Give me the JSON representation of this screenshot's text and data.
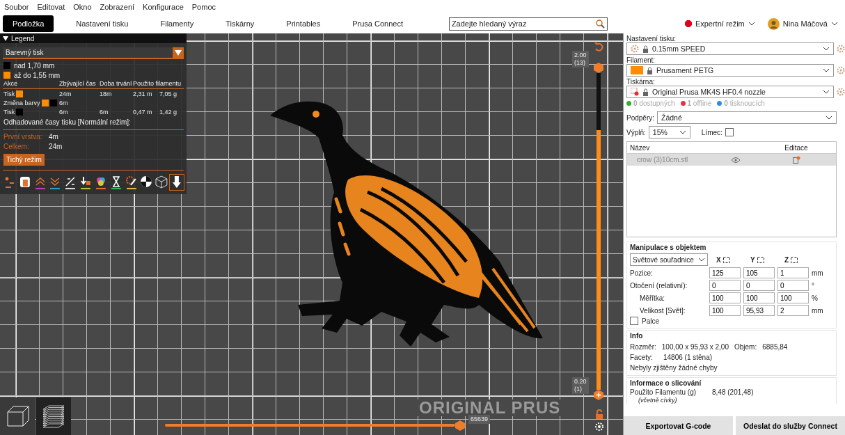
{
  "menu": [
    "Soubor",
    "Editovat",
    "Okno",
    "Zobrazení",
    "Konfigurace",
    "Pomoc"
  ],
  "tabs": [
    {
      "label": "Podložka",
      "selected": true
    },
    {
      "label": "Nastavení tisku",
      "selected": false
    },
    {
      "label": "Filamenty",
      "selected": false
    },
    {
      "label": "Tiskárny",
      "selected": false
    },
    {
      "label": "Printables",
      "selected": false
    },
    {
      "label": "Prusa Connect",
      "selected": false
    }
  ],
  "search": {
    "placeholder": "Zadejte hledaný výraz"
  },
  "mode": {
    "label": "Expertní režim",
    "color": "#e0001a"
  },
  "user": {
    "name": "Nina Máčová"
  },
  "legend": {
    "title": "Legend",
    "expanded": true,
    "view": "Barevný tisk",
    "ranges": [
      {
        "color": "#000000",
        "label": "nad 1,70 mm"
      },
      {
        "color": "#ff8c00",
        "label": "až do 1,55 mm"
      }
    ],
    "columns": [
      "Akce",
      "Zbývající čas",
      "Doba trvání",
      "Použito filamentu"
    ],
    "rows": [
      {
        "action": "Tisk",
        "colors": [
          {
            "color": "#ff8c00"
          }
        ],
        "remaining": "24m",
        "duration": "18m",
        "length": "2,31 m",
        "weight": "7,05 g"
      },
      {
        "action": "Změna barvy",
        "colors": [
          {
            "color": "#ff8c00"
          },
          {
            "color": "#000000"
          }
        ],
        "remaining": "6m",
        "duration": "",
        "length": "",
        "weight": ""
      },
      {
        "action": "Tisk",
        "colors": [
          {
            "color": "#000000"
          }
        ],
        "remaining": "6m",
        "duration": "6m",
        "length": "0,47 m",
        "weight": "1,42 g"
      }
    ],
    "estimate_title": "Odhadované časy tisku [Normální režim]:",
    "stats": [
      {
        "label": "První vrstva:",
        "value": "4m"
      },
      {
        "label": "Celkem:",
        "value": "24m"
      }
    ],
    "mode_button": "Tichý režim",
    "tools": [
      {
        "kind": "travel",
        "selected": false
      },
      {
        "kind": "wipe",
        "selected": false
      },
      {
        "kind": "retract",
        "selected": false
      },
      {
        "kind": "deretract",
        "selected": false
      },
      {
        "kind": "seams",
        "selected": false
      },
      {
        "kind": "toolchange",
        "selected": false
      },
      {
        "kind": "colors",
        "selected": false
      },
      {
        "kind": "pause",
        "selected": false
      },
      {
        "kind": "gcode",
        "selected": false
      },
      {
        "kind": "gravity",
        "selected": false
      },
      {
        "kind": "shells",
        "selected": false
      },
      {
        "kind": "marker",
        "selected": true
      }
    ]
  },
  "bed_logo": "ORIGINAL PRUS",
  "layer_slider": {
    "top_value": "2.00",
    "top_layer": "(13)",
    "bottom_value": "0.20",
    "bottom_layer": "(1)"
  },
  "move_slider": {
    "value": "65639",
    "level": 1
  },
  "print_settings": {
    "label": "Nastavení tisku:",
    "value": "0.15mm SPEED"
  },
  "filament": {
    "label": "Filament:",
    "value": "Prusament PETG",
    "color": "#ff8c00"
  },
  "printer": {
    "label": "Tiskárna:",
    "value": "Original Prusa MK4S HF0.4 nozzle"
  },
  "printer_status": [
    {
      "count": "0",
      "label": "dostupných",
      "color": "#2fb12f"
    },
    {
      "count": "1",
      "label": "offline",
      "color": "#e8323c"
    },
    {
      "count": "0",
      "label": "tisknoucích",
      "color": "#2f8ce8"
    }
  ],
  "supports": {
    "label": "Podpěry:",
    "value": "Žádné"
  },
  "infill": {
    "label": "Výplň:",
    "value": "15%"
  },
  "brim": {
    "label": "Límec:",
    "checked": false
  },
  "object_list": {
    "columns": [
      "Název",
      "Editace"
    ],
    "rows": [
      {
        "name": "crow (3)10cm.stl",
        "selected": true
      }
    ]
  },
  "manipulation": {
    "title": "Manipulace s objektem",
    "coords": "Světové souřadnice",
    "axes": [
      "X",
      "Y",
      "Z"
    ],
    "rows": [
      {
        "label": "Pozice:",
        "values": [
          "125",
          "105",
          "1"
        ],
        "unit": "mm"
      },
      {
        "label": "Otočení (relativní):",
        "values": [
          "0",
          "0",
          "0"
        ],
        "unit": "°"
      },
      {
        "label": "Měřítka:",
        "values": [
          "100",
          "100",
          "100"
        ],
        "unit": "%"
      },
      {
        "label": "Velikost [Svět]:",
        "values": [
          "100",
          "95,93",
          "2"
        ],
        "unit": "mm"
      }
    ],
    "inches": {
      "label": "Palce",
      "checked": false
    }
  },
  "info": {
    "title": "Info",
    "size_label": "Rozměr:",
    "size": "100,00 x 95,93 x 2,00",
    "volume_label": "Objem:",
    "volume": "6885,84",
    "facets_label": "Facety:",
    "facets": "14806 (1 stěna)",
    "errors": "Nebyly zjištěny žádné chyby"
  },
  "slicing": {
    "title": "Informace o slicování",
    "label": "Použito Filamentu (g)",
    "sublabel": "(včetně cívky)",
    "value": "8,48 (201,48)"
  },
  "buttons": [
    "Exportovat G-code",
    "Odeslat do služby Connect"
  ]
}
